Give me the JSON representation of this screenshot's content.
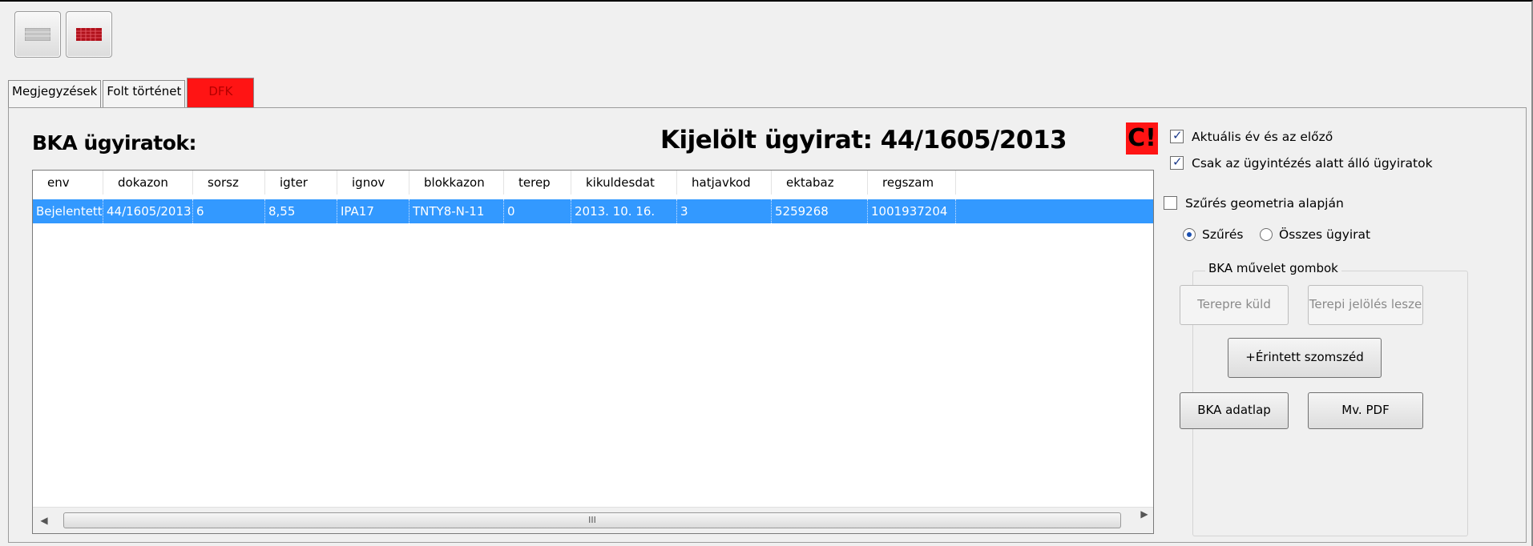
{
  "toolbar": {
    "buttons": [
      {
        "icon": "grey-table-icon",
        "color": "#b0b0b0"
      },
      {
        "icon": "red-grid-icon",
        "color": "#b0101a"
      }
    ]
  },
  "tabs": [
    {
      "label": "Megjegyzések"
    },
    {
      "label": "Folt történet"
    },
    {
      "label": "DFK",
      "color": "#ff1414"
    }
  ],
  "panel": {
    "title": "BKA ügyiratok:",
    "selected_title": "Kijelölt ügyirat: 44/1605/2013",
    "warning_badge": "C!"
  },
  "grid": {
    "columns": [
      "env",
      "dokazon",
      "sorsz",
      "igter",
      "ignov",
      "blokkazon",
      "terep",
      "kikuldesdat",
      "hatjavkod",
      "ektabaz",
      "regszam"
    ],
    "rows": [
      [
        "Bejelentett",
        "44/1605/2013",
        "6",
        "8,55",
        "IPA17",
        "TNTY8-N-11",
        "0",
        "2013. 10. 16.",
        "3",
        "5259268",
        "1001937204"
      ]
    ],
    "scroll_thumb_grip": "III",
    "selection_color": "#3399ff"
  },
  "filters": {
    "current_year": {
      "label": "Aktuális év és az előző",
      "checked": true
    },
    "in_progress": {
      "label": "Csak az ügyintézés alatt álló ügyiratok",
      "checked": true
    },
    "geometry": {
      "label": "Szűrés geometria alapján",
      "checked": false
    },
    "radio_filter": {
      "label": "Szűrés",
      "selected": true
    },
    "radio_all": {
      "label": "Összes ügyirat",
      "selected": false
    }
  },
  "actions": {
    "group_label": "BKA művelet gombok",
    "send_field": "Terepre küld",
    "field_marking": "Terepi jelölés lesze",
    "affected_neighbor": "+Érintett szomszéd",
    "bka_datasheet": "BKA adatlap",
    "mv_pdf": "Mv. PDF"
  }
}
